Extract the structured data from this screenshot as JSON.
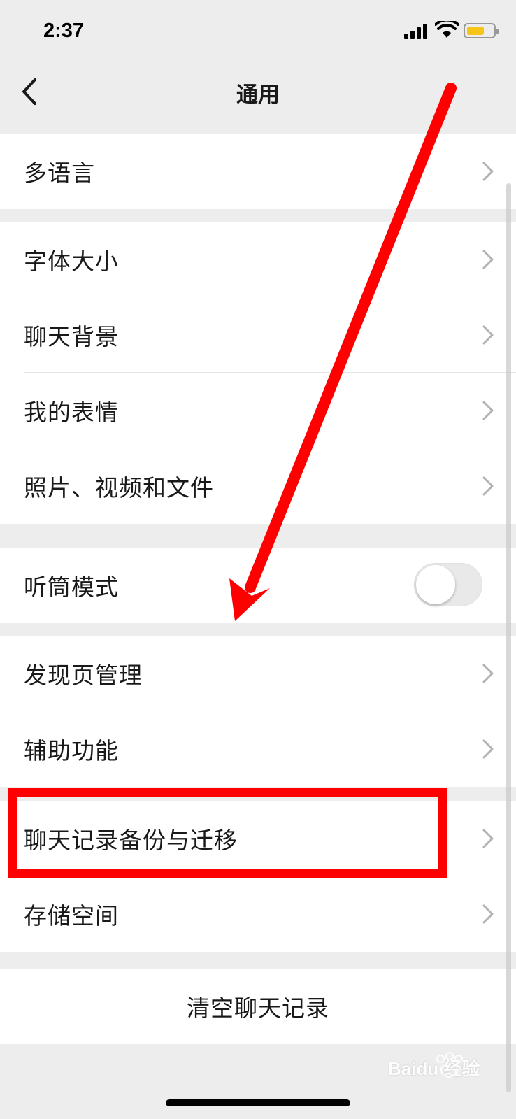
{
  "status_bar": {
    "time": "2:37",
    "icons": [
      "signal-icon",
      "wifi-icon",
      "battery-icon"
    ],
    "battery_color": "#f5c518"
  },
  "nav": {
    "title": "通用",
    "back_icon": "chevron-left-icon"
  },
  "groups": [
    {
      "items": [
        {
          "label": "多语言",
          "type": "link"
        }
      ]
    },
    {
      "items": [
        {
          "label": "字体大小",
          "type": "link"
        },
        {
          "label": "聊天背景",
          "type": "link"
        },
        {
          "label": "我的表情",
          "type": "link"
        },
        {
          "label": "照片、视频和文件",
          "type": "link"
        }
      ]
    },
    {
      "items": [
        {
          "label": "听筒模式",
          "type": "toggle",
          "value": false
        }
      ]
    },
    {
      "items": [
        {
          "label": "发现页管理",
          "type": "link"
        },
        {
          "label": "辅助功能",
          "type": "link"
        }
      ]
    },
    {
      "items": [
        {
          "label": "聊天记录备份与迁移",
          "type": "link"
        },
        {
          "label": "存储空间",
          "type": "link"
        }
      ]
    }
  ],
  "clear_button": {
    "label": "清空聊天记录"
  },
  "annotations": {
    "color": "#ff0000",
    "arrow": "red-arrow",
    "highlight_target": "聊天记录备份与迁移"
  },
  "watermark": {
    "text": "Baidu 经验",
    "icon": "baidu-paw-icon"
  },
  "colors": {
    "background": "#ededed",
    "cell": "#ffffff",
    "text": "#191919",
    "chevron": "#b2b2b2"
  }
}
